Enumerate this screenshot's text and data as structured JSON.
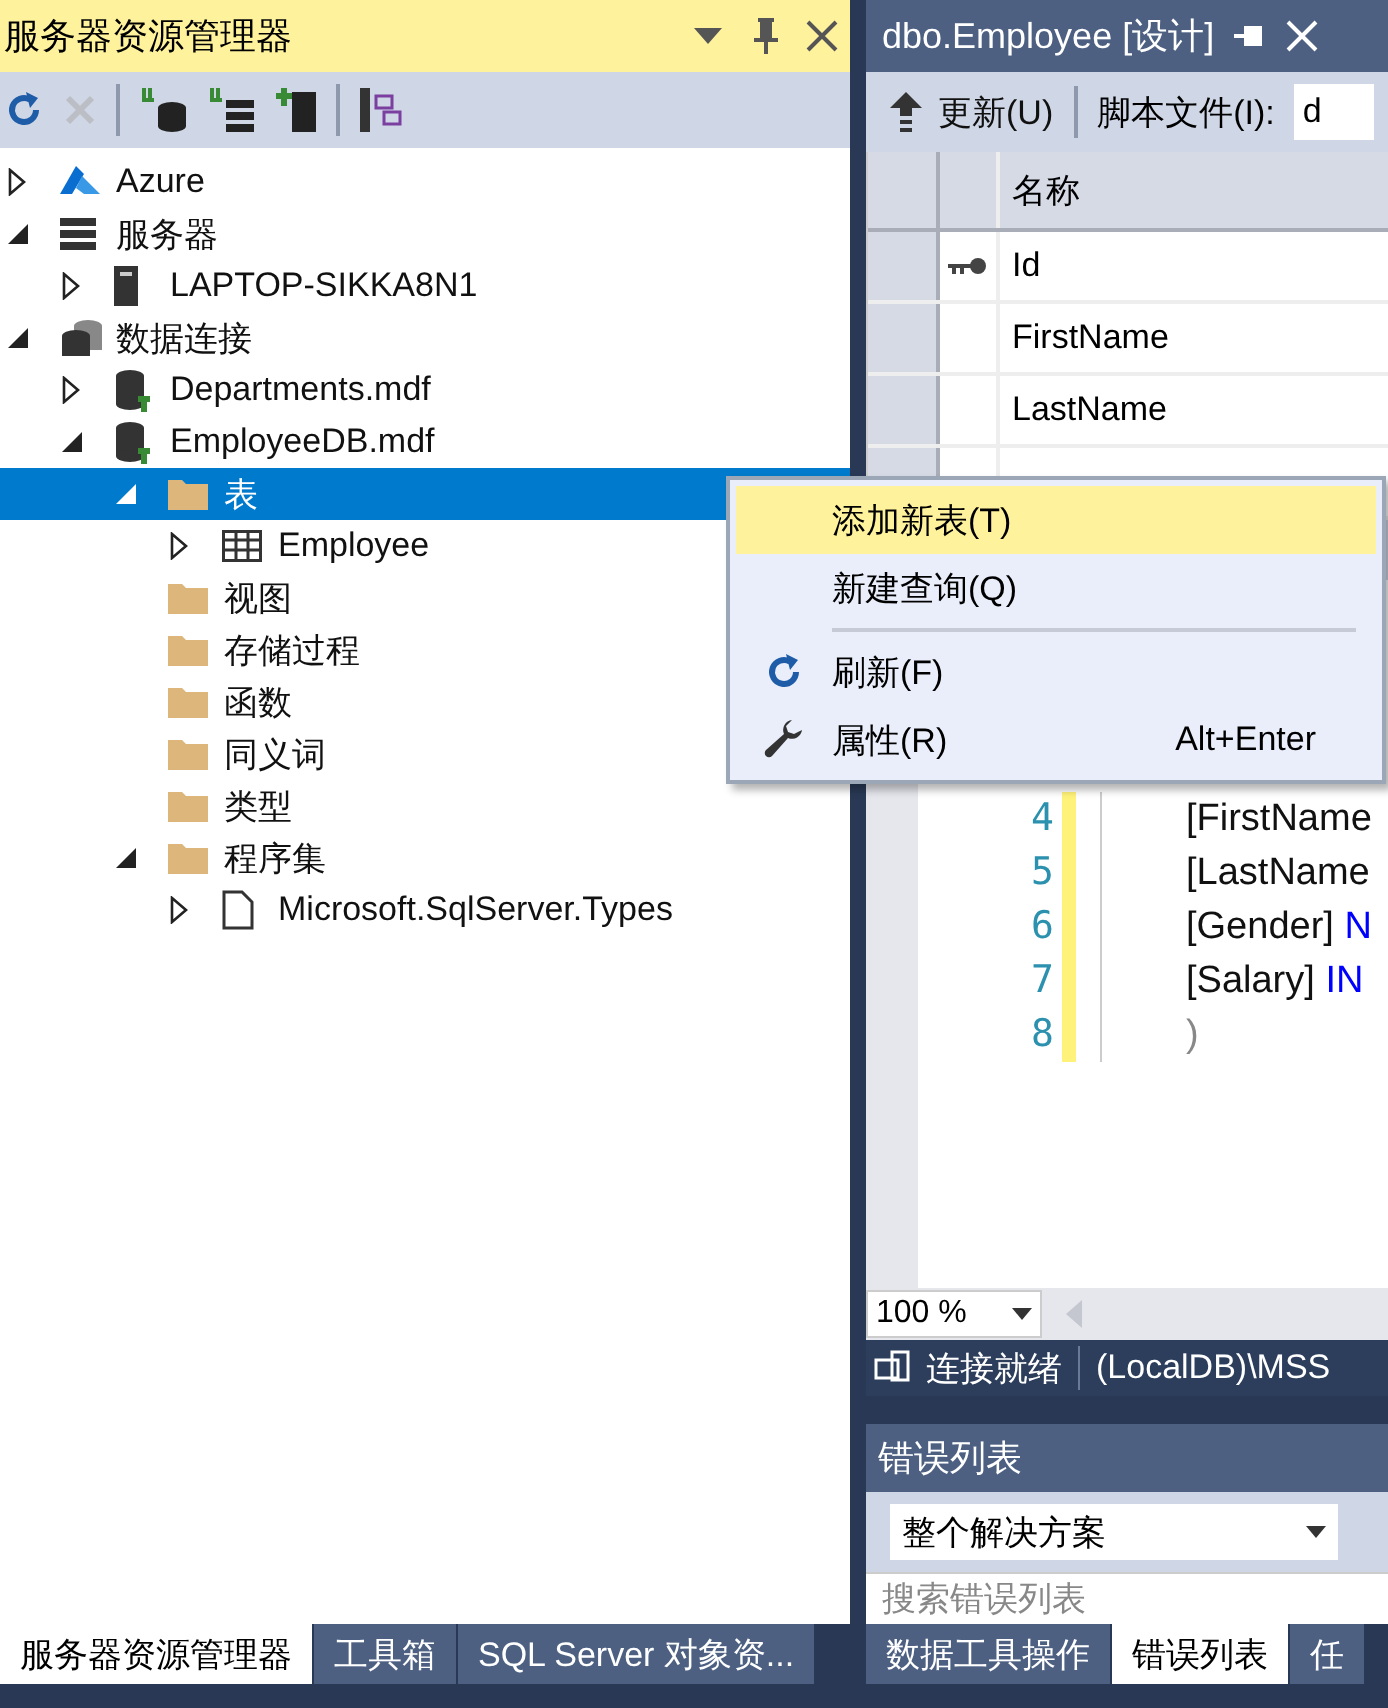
{
  "explorer": {
    "title": "服务器资源管理器",
    "toolbar": [
      {
        "kind": "refresh",
        "disabled": false
      },
      {
        "kind": "cancel",
        "disabled": true
      },
      {
        "kind": "separator"
      },
      {
        "kind": "connect-db",
        "disabled": false
      },
      {
        "kind": "connect-server",
        "disabled": false
      },
      {
        "kind": "add-server",
        "disabled": false
      },
      {
        "kind": "separator"
      },
      {
        "kind": "diagram",
        "disabled": false
      }
    ],
    "tree": [
      {
        "label": "Azure",
        "kind": "azure",
        "expanded": false,
        "selected": false
      },
      {
        "label": "服务器",
        "kind": "servers",
        "expanded": true,
        "selected": false,
        "children": [
          {
            "label": "LAPTOP-SIKKA8N1",
            "kind": "server",
            "expanded": false,
            "selected": false
          }
        ]
      },
      {
        "label": "数据连接",
        "kind": "connections",
        "expanded": true,
        "selected": false,
        "children": [
          {
            "label": "Departments.mdf",
            "kind": "database",
            "expanded": false,
            "selected": false
          },
          {
            "label": "EmployeeDB.mdf",
            "kind": "database",
            "expanded": true,
            "selected": false,
            "children": [
              {
                "label": "表",
                "kind": "folder",
                "expanded": true,
                "selected": true,
                "children": [
                  {
                    "label": "Employee",
                    "kind": "table",
                    "expanded": false,
                    "selected": false
                  }
                ]
              },
              {
                "label": "视图",
                "kind": "folder",
                "selected": false
              },
              {
                "label": "存储过程",
                "kind": "folder",
                "selected": false
              },
              {
                "label": "函数",
                "kind": "folder",
                "selected": false
              },
              {
                "label": "同义词",
                "kind": "folder",
                "selected": false
              },
              {
                "label": "类型",
                "kind": "folder",
                "selected": false
              },
              {
                "label": "程序集",
                "kind": "folder",
                "expanded": true,
                "selected": false,
                "children": [
                  {
                    "label": "Microsoft.SqlServer.Types",
                    "kind": "assembly",
                    "expanded": false,
                    "selected": false
                  }
                ]
              }
            ]
          }
        ]
      }
    ],
    "tabs": [
      {
        "label": "服务器资源管理器",
        "selected": true
      },
      {
        "label": "工具箱",
        "selected": false
      },
      {
        "label": "SQL Server 对象资...",
        "selected": false
      }
    ]
  },
  "designer": {
    "tab_title": "dbo.Employee [设计]",
    "update_button": "更新(U)",
    "script_label": "脚本文件(I):",
    "script_value": "d",
    "grid_header": "名称",
    "grid_rows": [
      {
        "name": "Id",
        "primary_key": true
      },
      {
        "name": "FirstName",
        "primary_key": false
      },
      {
        "name": "LastName",
        "primary_key": false
      }
    ],
    "code": [
      {
        "number": "4",
        "tokens": [
          {
            "text": "[FirstName",
            "kind": "ident"
          }
        ]
      },
      {
        "number": "5",
        "tokens": [
          {
            "text": "[LastName",
            "kind": "ident"
          }
        ]
      },
      {
        "number": "6",
        "tokens": [
          {
            "text": "[Gender] ",
            "kind": "ident"
          },
          {
            "text": "N",
            "kind": "keyword"
          }
        ]
      },
      {
        "number": "7",
        "tokens": [
          {
            "text": "[Salary] ",
            "kind": "ident"
          },
          {
            "text": "IN",
            "kind": "keyword"
          }
        ]
      },
      {
        "number": "8",
        "tokens": [
          {
            "text": ")",
            "kind": "punct"
          }
        ]
      }
    ],
    "zoom": "100 %",
    "status": "连接就绪",
    "server": "(LocalDB)\\MSS"
  },
  "error_list": {
    "title": "错误列表",
    "scope": "整个解决方案",
    "search": {
      "placeholder": "搜索错误列表"
    },
    "tabs": [
      {
        "label": "数据工具操作",
        "selected": false
      },
      {
        "label": "错误列表",
        "selected": true
      },
      {
        "label": "任",
        "selected": false
      }
    ]
  },
  "context_menu": [
    {
      "kind": "plain",
      "label": "添加新表(T)",
      "selected": true
    },
    {
      "kind": "plain",
      "label": "新建查询(Q)",
      "selected": false
    },
    {
      "kind": "separator"
    },
    {
      "kind": "refresh",
      "label": "刷新(F)",
      "selected": false
    },
    {
      "kind": "properties",
      "label": "属性(R)",
      "shortcut": "Alt+Enter",
      "selected": false
    }
  ]
}
